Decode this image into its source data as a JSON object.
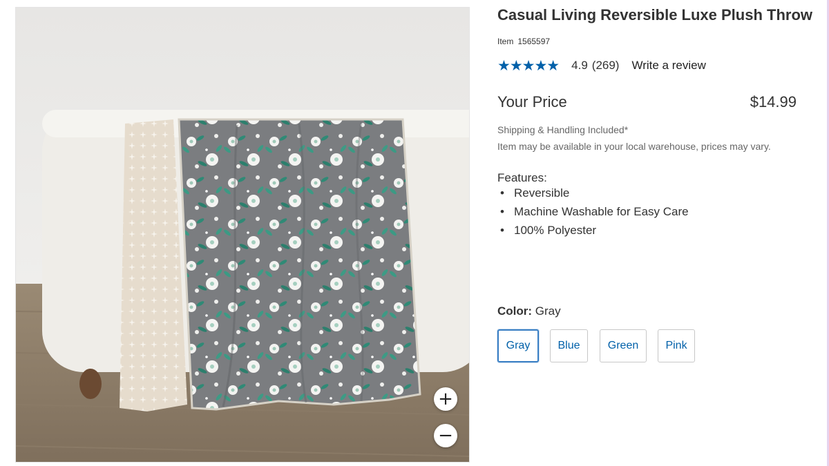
{
  "product": {
    "title": "Casual Living Reversible Luxe Plush Throw",
    "item_label": "Item",
    "item_number": "1565597",
    "image_alt": "Gray floral reversible plush throw draped over a white ottoman"
  },
  "rating": {
    "stars_icon": "★★★★★",
    "value": "4.9",
    "count": "(269)",
    "review_link": "Write a review",
    "star_color": "#0060a9"
  },
  "price": {
    "label": "Your Price",
    "amount": "$14.99"
  },
  "shipping": {
    "line1": "Shipping & Handling Included*",
    "line2": "Item may be available in your local warehouse, prices may vary."
  },
  "features": {
    "label": "Features:",
    "items": [
      "Reversible",
      "Machine Washable for Easy Care",
      "100% Polyester"
    ]
  },
  "color": {
    "label": "Color:",
    "selected": "Gray",
    "options": [
      "Gray",
      "Blue",
      "Green",
      "Pink"
    ]
  },
  "zoom": {
    "in_icon": "+",
    "out_icon": "−"
  },
  "icons": [
    "star-icon",
    "zoom-in-icon",
    "zoom-out-icon"
  ]
}
